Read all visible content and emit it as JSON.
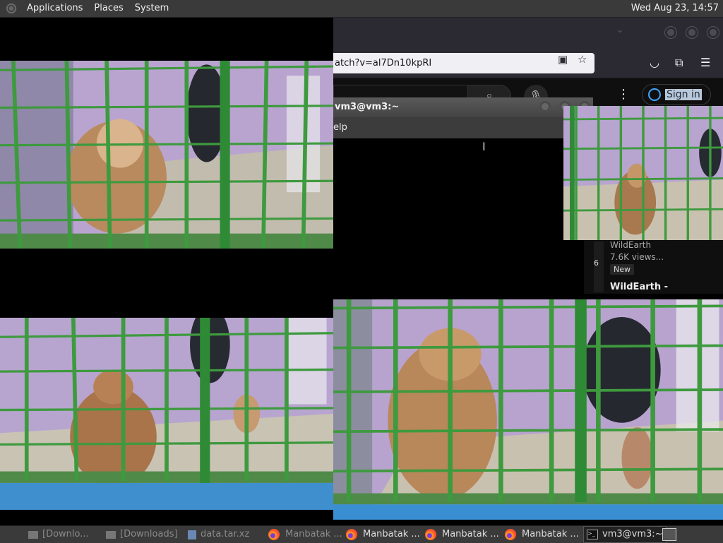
{
  "top_panel": {
    "menus": [
      "Applications",
      "Places",
      "System"
    ],
    "clock": "Wed Aug 23, 14:57"
  },
  "browser": {
    "url": "atch?v=al7Dn10kpRI",
    "sign_in_label": "Sign in",
    "icons": [
      "reader-view-icon",
      "bookmark-star-icon",
      "pocket-icon",
      "extensions-icon",
      "hamburger-menu-icon"
    ]
  },
  "terminal": {
    "title": "vm3@vm3:~",
    "menu_visible_text": "elp"
  },
  "youtube_card": {
    "channel": "WildEarth",
    "views": "7.6K views...",
    "badge": "New",
    "title": "WildEarth -",
    "thumb_number": "6"
  },
  "taskbar": {
    "items": [
      {
        "label": "[Downlo...",
        "icon": "folder-icon",
        "state": "hidden-partial"
      },
      {
        "label": "[Downloads]",
        "icon": "folder-icon",
        "state": "hidden-partial"
      },
      {
        "label": "data.tar.xz",
        "icon": "archive-icon",
        "state": "hidden-partial"
      },
      {
        "label": "Manbatak ...",
        "icon": "firefox-icon",
        "state": "hidden-partial"
      },
      {
        "label": "Manbatak ...",
        "icon": "firefox-icon",
        "state": "normal"
      },
      {
        "label": "Manbatak ...",
        "icon": "firefox-icon",
        "state": "normal"
      },
      {
        "label": "Manbatak ...",
        "icon": "firefox-icon",
        "state": "normal"
      },
      {
        "label": "vm3@vm3:~",
        "icon": "terminal-icon",
        "state": "active"
      }
    ]
  },
  "colors": {
    "panel": "#3a3a3a",
    "browser_chrome": "#2b2a33",
    "cage_green": "#3e9a3e",
    "wall_purple": "#a587c4",
    "floor_blue": "#2f8fd6"
  }
}
